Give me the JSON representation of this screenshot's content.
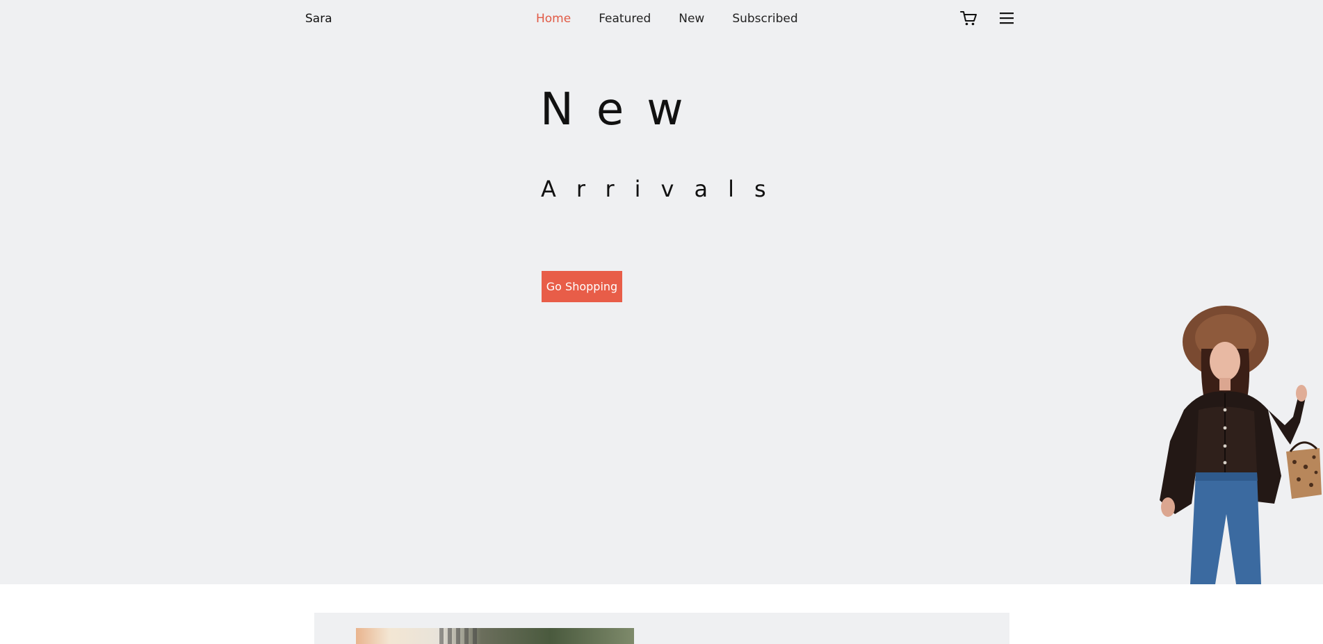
{
  "brand": "Sara",
  "nav": {
    "items": [
      {
        "label": "Home",
        "active": true
      },
      {
        "label": "Featured",
        "active": false
      },
      {
        "label": "New",
        "active": false
      },
      {
        "label": "Subscribed",
        "active": false
      }
    ],
    "icons": [
      "cart-icon",
      "menu-icon"
    ]
  },
  "hero": {
    "line1": "New",
    "line2": "Arrivals",
    "cta_label": "Go Shopping",
    "image": "model-in-leather-shirt-and-hat"
  },
  "colors": {
    "accent": "#e85d48",
    "active_nav": "#e15a45",
    "hero_bg": "#eff0f2"
  }
}
